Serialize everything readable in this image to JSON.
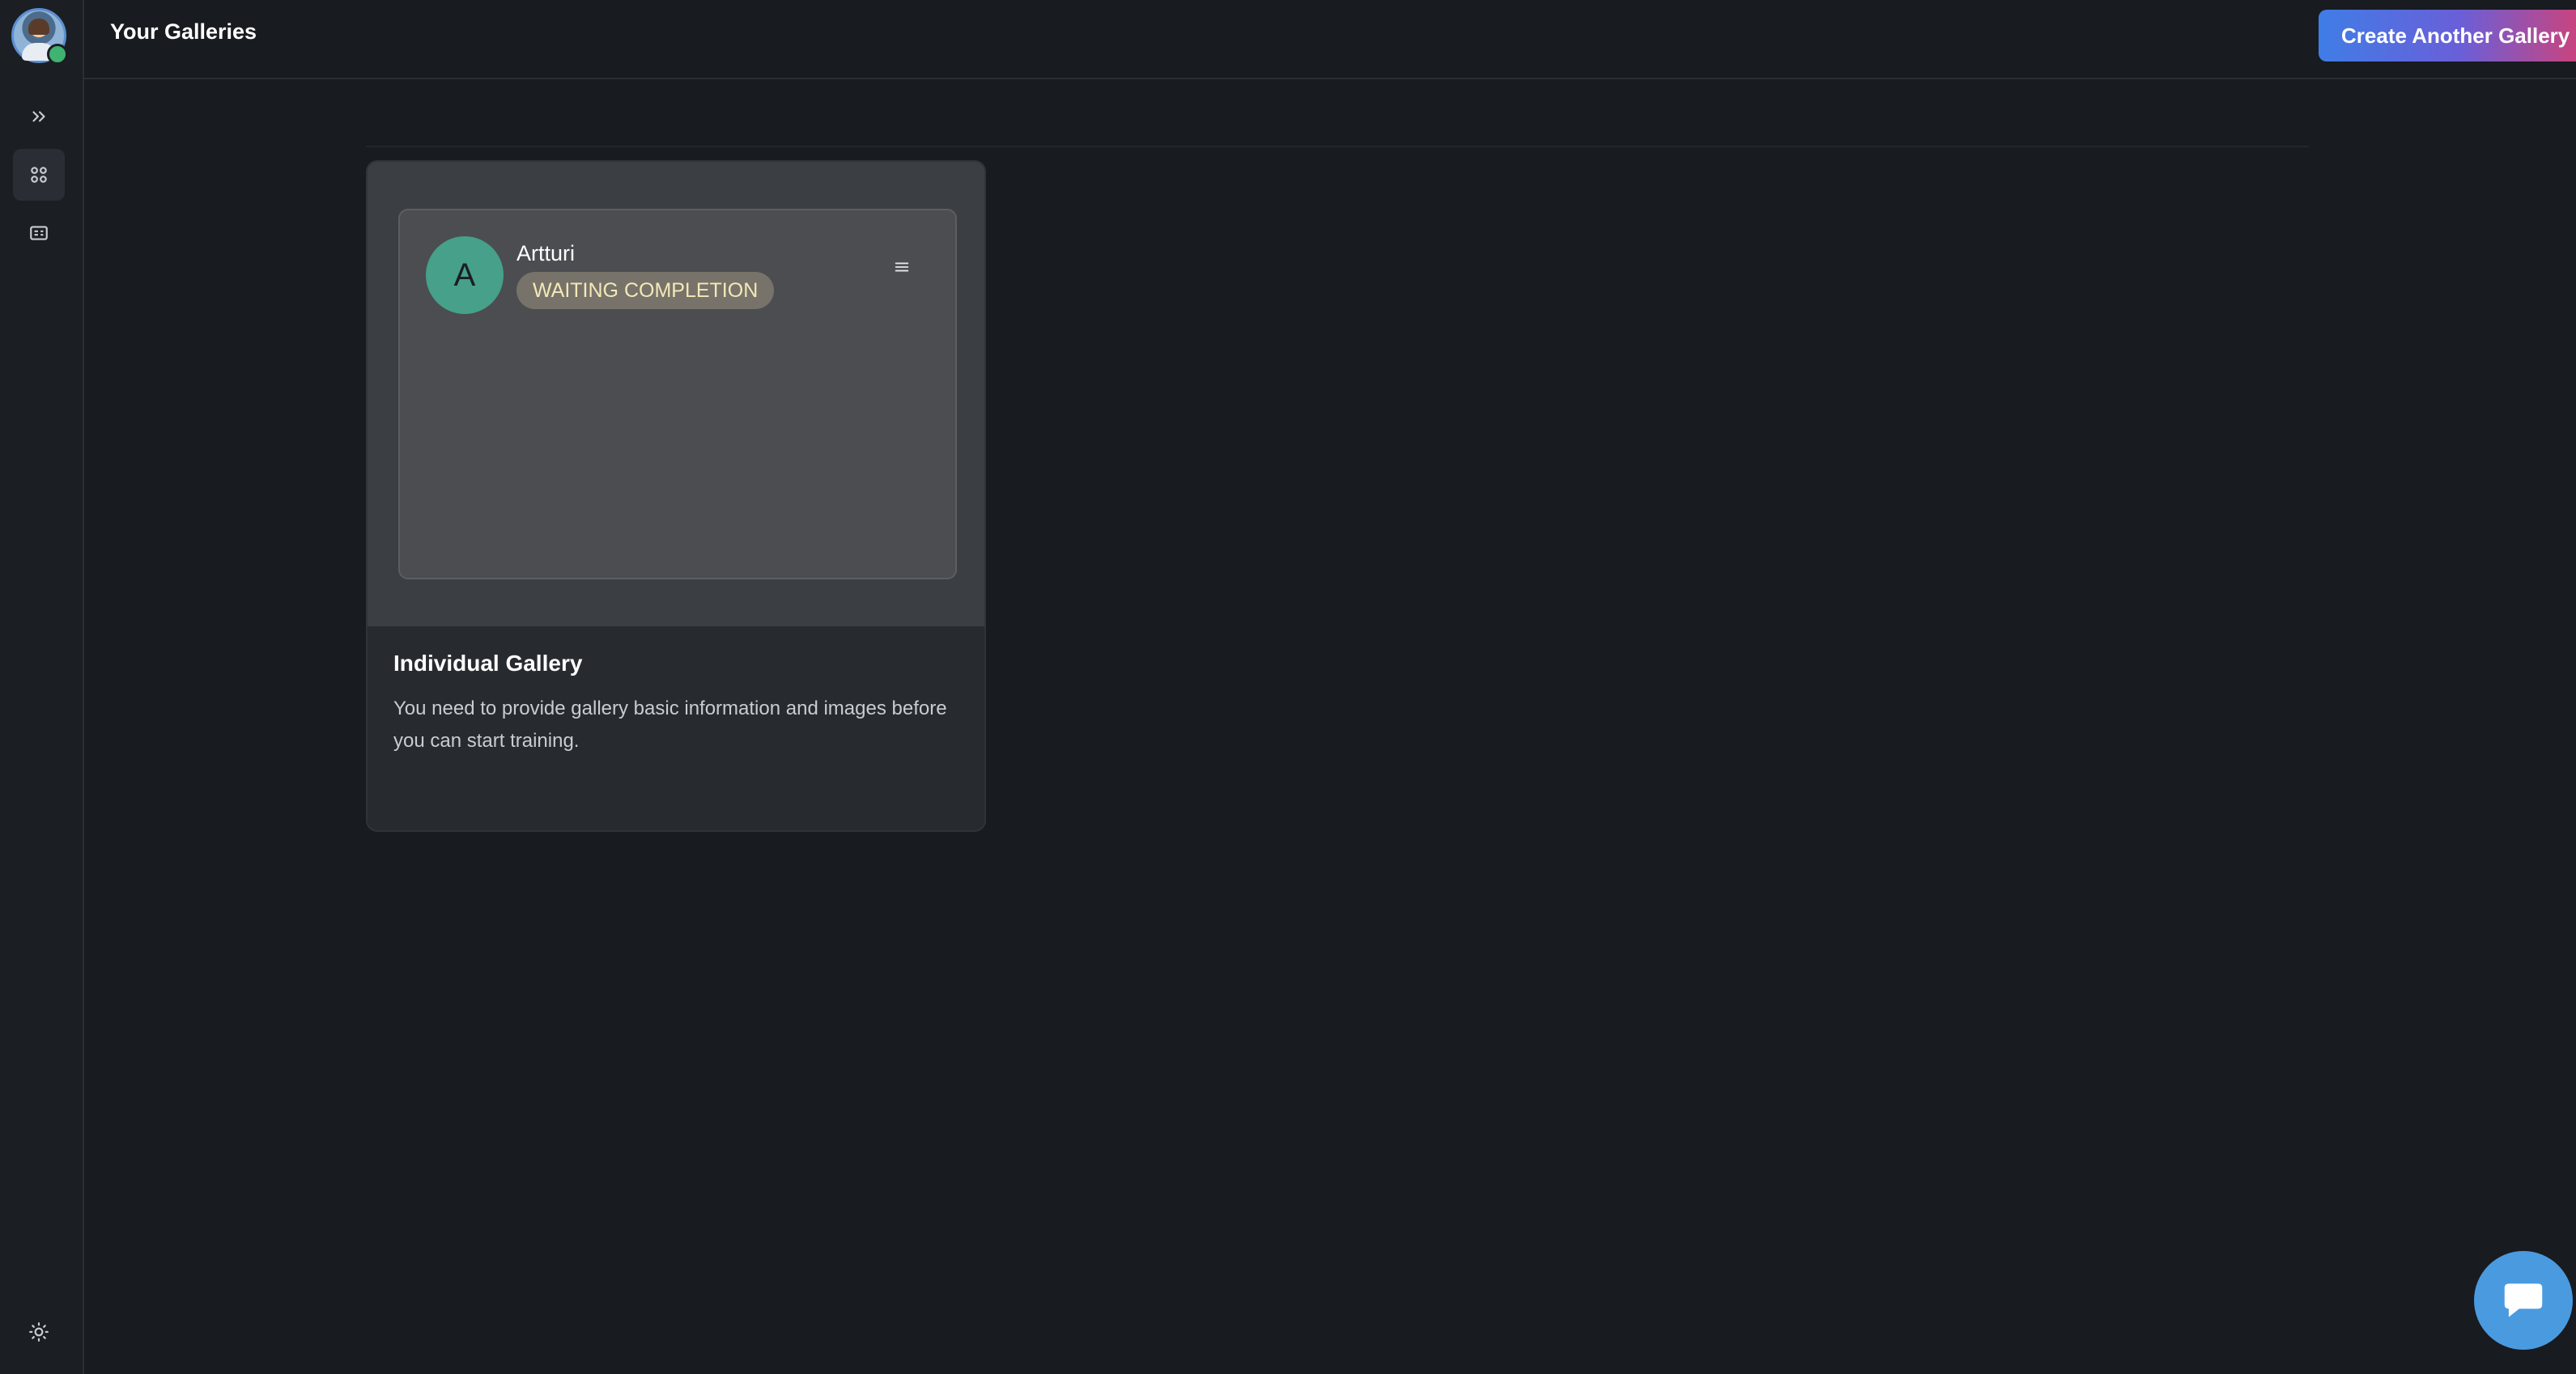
{
  "header": {
    "title": "Your Galleries",
    "create_button_label": "Create Another Gallery"
  },
  "sidebar": {
    "items": [
      {
        "name": "expand",
        "icon": "chevrons-right-icon"
      },
      {
        "name": "galleries",
        "icon": "grid-icon",
        "active": true
      },
      {
        "name": "gallery-list",
        "icon": "card-list-icon"
      }
    ],
    "bottom_icon": "sun-icon"
  },
  "gallery": {
    "user_initial": "A",
    "user_name": "Artturi",
    "status": "WAITING COMPLETION",
    "title": "Individual Gallery",
    "description": "You need to provide gallery basic information and images before you can start training."
  },
  "colors": {
    "background": "#181b20",
    "avatar_green": "#46a08a",
    "chat_blue": "#4a9ae0",
    "gradient_start": "#3f7de6",
    "gradient_end": "#c8447f"
  }
}
